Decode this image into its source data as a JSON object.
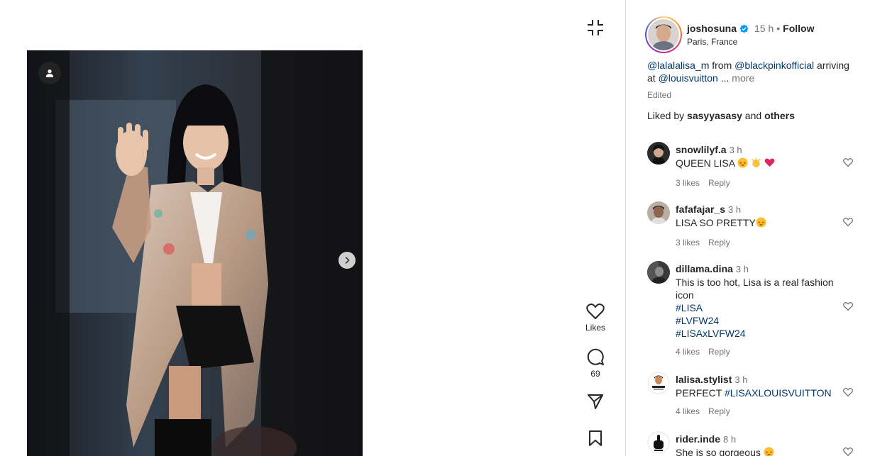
{
  "post": {
    "author": "joshosuna",
    "time": "15 h",
    "follow": "Follow",
    "location": "Paris, France",
    "caption": {
      "mention1": "@lalalalisa_m",
      "from": " from ",
      "mention2": "@blackpinkofficial",
      "arriving": " arriving at ",
      "mention3": "@louisvuitton",
      "ellipsis": " ... ",
      "more": "more"
    },
    "edited": "Edited",
    "liked": {
      "prefix": "Liked by ",
      "user": "sasyyasasy",
      "and": " and ",
      "others": "others"
    }
  },
  "actions": {
    "like_label": "Likes",
    "comment_count": "69"
  },
  "comments": [
    {
      "user": "snowlilyf.a",
      "time": "3 h",
      "text": "QUEEN LISA",
      "likes": "3 likes",
      "reply": "Reply"
    },
    {
      "user": "fafafajar_s",
      "time": "3 h",
      "text": "LISA SO PRETTY",
      "likes": "3 likes",
      "reply": "Reply"
    },
    {
      "user": "dillama.dina",
      "time": "3 h",
      "text": "This is too hot, Lisa is a real fashion icon",
      "tags": [
        "#LISA",
        "#LVFW24",
        "#LISAxLVFW24"
      ],
      "likes": "4 likes",
      "reply": "Reply"
    },
    {
      "user": "lalisa.stylist",
      "time": "3 h",
      "text": "PERFECT ",
      "tag": "#LISAXLOUISVUITTON",
      "likes": "4 likes",
      "reply": "Reply"
    },
    {
      "user": "rider.inde",
      "time": "8 h",
      "text": "She is so gorgeous"
    }
  ],
  "colors": {
    "link": "#00376b",
    "muted": "#737373",
    "verified": "#0095f6",
    "divider": "#dbdbdb"
  },
  "icons": [
    "collapse-icon",
    "heart-icon",
    "comment-icon",
    "share-icon",
    "save-icon",
    "tag-user-icon",
    "chevron-right-icon",
    "verified-icon"
  ]
}
